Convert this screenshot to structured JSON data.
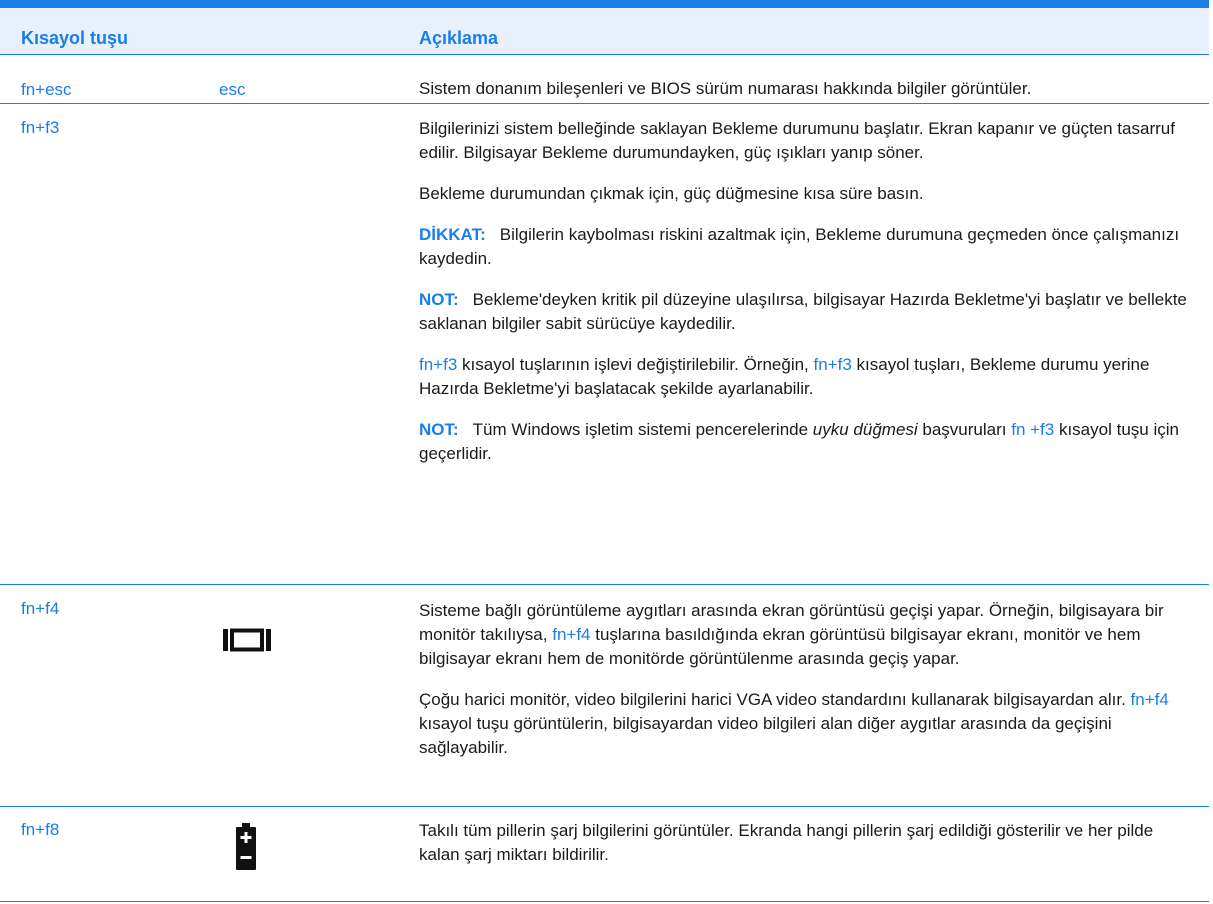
{
  "table": {
    "header": {
      "key": "Kısayol tuşu",
      "description": "Açıklama"
    },
    "rows": [
      {
        "key": "fn+esc",
        "icon_text": "esc",
        "description": "Sistem donanım bileşenleri ve BIOS sürüm numarası hakkında bilgiler görüntüler."
      },
      {
        "key": "fn+f3",
        "icon": "moon-sleep-icon",
        "p1": "Bilgilerinizi sistem belleğinde saklayan Bekleme durumunu başlatır. Ekran kapanır ve güçten tasarruf edilir. Bilgisayar Bekleme durumundayken, güç ışıkları yanıp söner.",
        "p2": "Bekleme durumundan çıkmak için, güç düğmesine kısa süre basın.",
        "caution_label": "DİKKAT:",
        "caution_text": "Bilgilerin kaybolması riskini azaltmak için, Bekleme durumuna geçmeden önce çalışmanızı kaydedin.",
        "note1_label": "NOT:",
        "note1_text": "Bekleme'deyken kritik pil düzeyine ulaşılırsa, bilgisayar Hazırda Bekletme'yi başlatır ve bellekte saklanan bilgiler sabit sürücüye kaydedilir.",
        "p5_link1": "fn+f3",
        "p5_text1": " kısayol tuşlarının işlevi değiştirilebilir. Örneğin, ",
        "p5_link2": "fn+f3",
        "p5_text2": " kısayol tuşları, Bekleme durumu yerine Hazırda Bekletme'yi başlatacak şekilde ayarlanabilir.",
        "note2_label": "NOT:",
        "note2_text1": "Tüm Windows işletim sistemi pencerelerinde ",
        "note2_italic": "uyku düğmesi",
        "note2_text2": " başvuruları ",
        "note2_link": "fn +f3",
        "note2_text3": " kısayol tuşu için geçerlidir."
      },
      {
        "key": "fn+f4",
        "icon": "display-switch-icon",
        "p1_text1": "Sisteme bağlı görüntüleme aygıtları arasında ekran görüntüsü geçişi yapar. Örneğin, bilgisayara bir monitör takılıysa, ",
        "p1_link": "fn+f4",
        "p1_text2": " tuşlarına basıldığında ekran görüntüsü bilgisayar ekranı, monitör ve hem bilgisayar ekranı hem de monitörde görüntülenme arasında geçiş yapar.",
        "p2_text1": "Çoğu harici monitör, video bilgilerini harici VGA video standardını kullanarak bilgisayardan alır. ",
        "p2_link": "fn+f4",
        "p2_text2": " kısayol tuşu görüntülerin, bilgisayardan video bilgileri alan diğer aygıtlar arasında da geçişini sağlayabilir."
      },
      {
        "key": "fn+f8",
        "icon": "battery-icon",
        "description": "Takılı tüm pillerin şarj bilgilerini görüntüler. Ekranda hangi pillerin şarj edildiği gösterilir ve her pilde kalan şarj miktarı bildirilir."
      }
    ]
  },
  "colors": {
    "accent": "#1a7ee8",
    "header_bg": "#e8f1fb",
    "text": "#1a1a1a"
  }
}
